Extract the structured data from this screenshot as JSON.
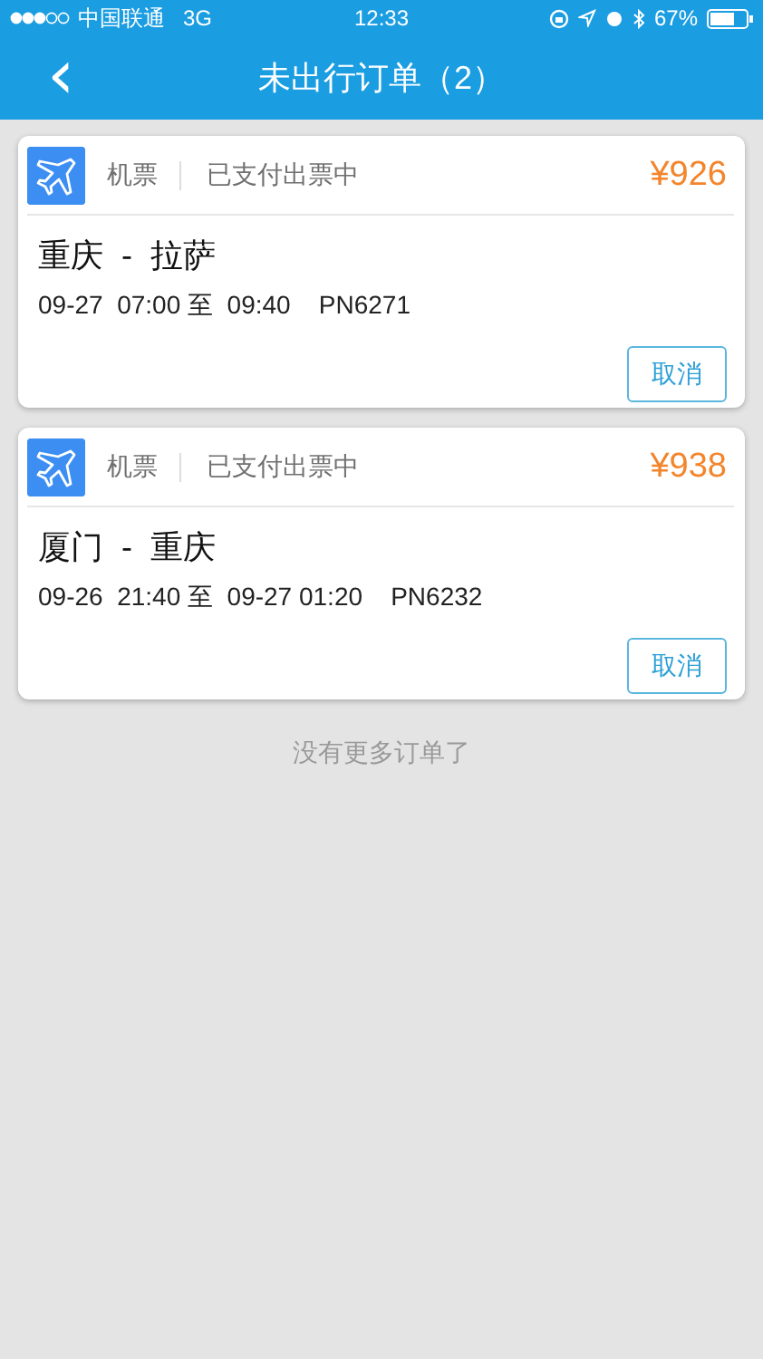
{
  "status_bar": {
    "carrier": "中国联通",
    "network": "3G",
    "time": "12:33",
    "battery": "67%"
  },
  "nav_bar": {
    "back": "‹",
    "title": "未出行订单（2）"
  },
  "orders": [
    {
      "category": "机票",
      "status": "已支付出票中",
      "price": "¥926",
      "route": "重庆  -  拉萨",
      "details": "09-27  07:00 至  09:40    PN6271",
      "action": "取消"
    },
    {
      "category": "机票",
      "status": "已支付出票中",
      "price": "¥938",
      "route": "厦门  -  重庆",
      "details": "09-26  21:40 至  09-27 01:20    PN6232",
      "action": "取消"
    }
  ],
  "footer": "没有更多订单了"
}
